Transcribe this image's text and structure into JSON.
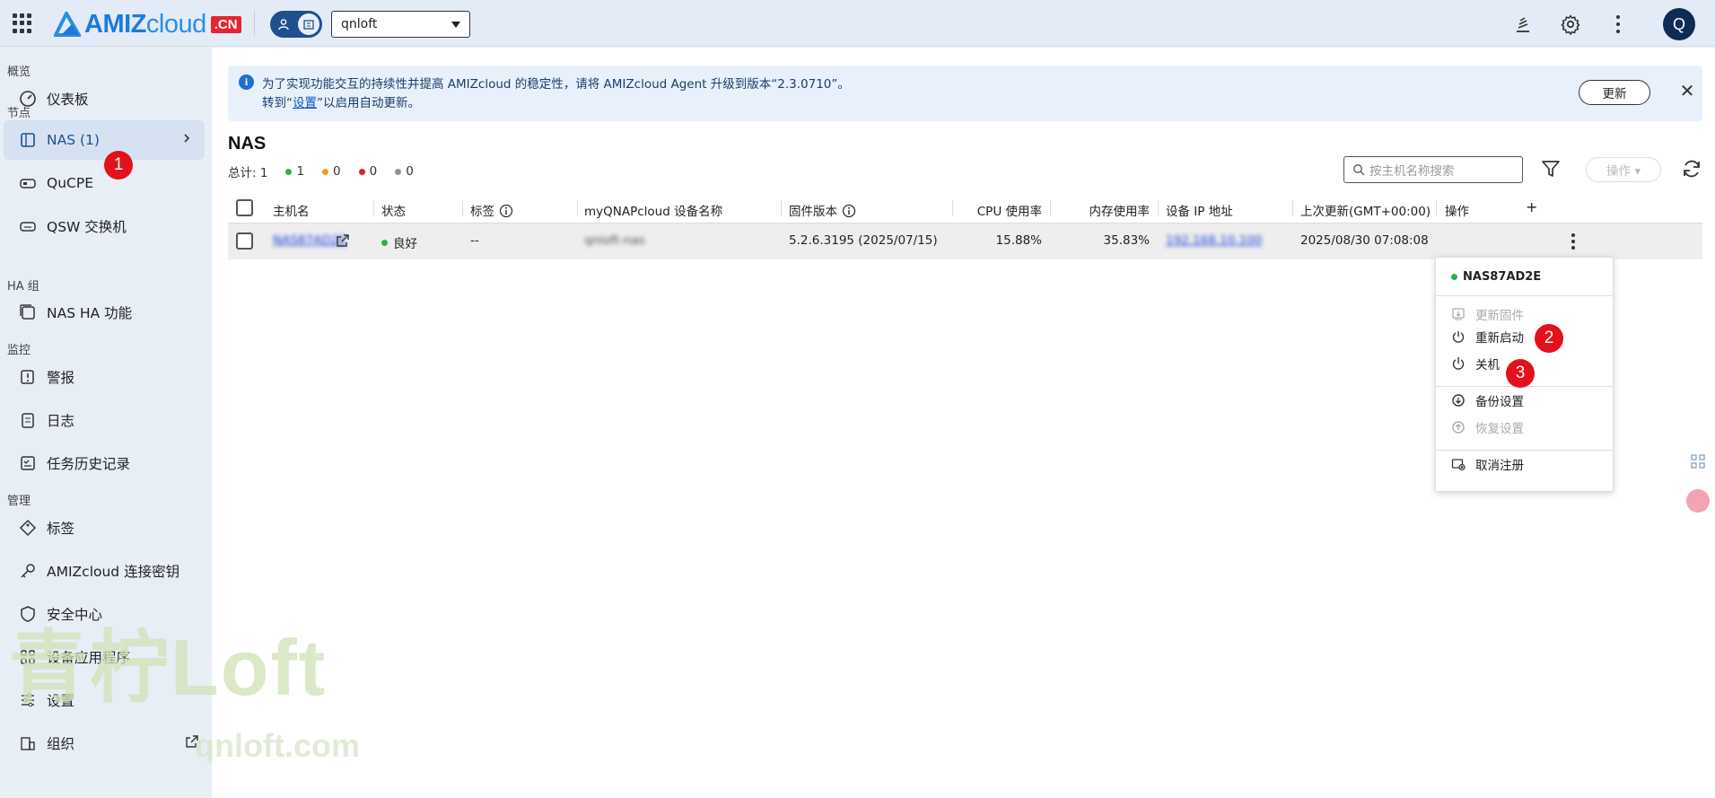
{
  "brand": {
    "name_bold": "AMIZ",
    "name_light": "cloud",
    "suffix": ".CN"
  },
  "org_select": {
    "value": "qnloft"
  },
  "user_avatar": {
    "initial": "Q"
  },
  "sidebar": {
    "sections": [
      "概览",
      "节点",
      "HA 组",
      "监控",
      "管理"
    ],
    "items": [
      {
        "label": "仪表板",
        "icon": "speedometer-icon"
      },
      {
        "label": "NAS (1)",
        "icon": "nas-icon"
      },
      {
        "label": "QuCPE",
        "icon": "router-icon"
      },
      {
        "label": "QSW 交换机",
        "icon": "switch-icon"
      },
      {
        "label": "NAS HA 功能",
        "icon": "nas-ha-icon"
      },
      {
        "label": "警报",
        "icon": "alert-icon"
      },
      {
        "label": "日志",
        "icon": "log-icon"
      },
      {
        "label": "任务历史记录",
        "icon": "task-history-icon"
      },
      {
        "label": "标签",
        "icon": "tag-icon"
      },
      {
        "label": "AMIZcloud 连接密钥",
        "icon": "key-icon"
      },
      {
        "label": "安全中心",
        "icon": "shield-icon"
      },
      {
        "label": "设备应用程序",
        "icon": "apps-icon"
      },
      {
        "label": "设置",
        "icon": "settings-sliders-icon"
      },
      {
        "label": "组织",
        "icon": "organization-icon"
      }
    ]
  },
  "banner": {
    "line1": "为了实现功能交互的持续性并提高 AMIZcloud 的稳定性，请将 AMIZcloud Agent 升级到版本“2.3.0710”。",
    "line2_pre": "转到“",
    "line2_link": "设置",
    "line2_post": "”以启用自动更新。",
    "update_label": "更新",
    "close": "✕"
  },
  "page": {
    "title": "NAS",
    "total_label": "总计: 1",
    "counts": [
      {
        "value": "1",
        "color": "#2db24a"
      },
      {
        "value": "0",
        "color": "#f39a2b"
      },
      {
        "value": "0",
        "color": "#d9212c"
      },
      {
        "value": "0",
        "color": "#8a95a3"
      }
    ],
    "search_placeholder": "按主机名称搜索",
    "action_label": "操作 ▾"
  },
  "table": {
    "headers": [
      "主机名",
      "状态",
      "标签",
      "myQNAPcloud 设备名称",
      "固件版本",
      "CPU 使用率",
      "内存使用率",
      "设备 IP 地址",
      "上次更新(GMT+00:00)",
      "操作",
      "+"
    ],
    "rows": [
      {
        "hostname": "NAS87AD2E",
        "status": "良好",
        "tags": "--",
        "device_name": "qnloft-nas",
        "firmware": "5.2.6.3195 (2025/07/15)",
        "cpu": "15.88%",
        "memory": "35.83%",
        "ip": "192.168.10.100",
        "last_update": "2025/08/30 07:08:08"
      }
    ]
  },
  "menu": {
    "title": "NAS87AD2E",
    "items": [
      {
        "label": "更新固件",
        "icon": "firmware-update-icon",
        "disabled": true
      },
      {
        "label": "重新启动",
        "icon": "restart-icon",
        "disabled": false
      },
      {
        "label": "关机",
        "icon": "power-icon",
        "disabled": false
      },
      {
        "label": "备份设置",
        "icon": "backup-icon",
        "disabled": false
      },
      {
        "label": "恢复设置",
        "icon": "restore-icon",
        "disabled": true
      },
      {
        "label": "取消注册",
        "icon": "unregister-icon",
        "disabled": false
      }
    ]
  },
  "badges": [
    "1",
    "2",
    "3"
  ],
  "watermark": {
    "main": "青柠Loft",
    "sub": "qnloft.com"
  }
}
